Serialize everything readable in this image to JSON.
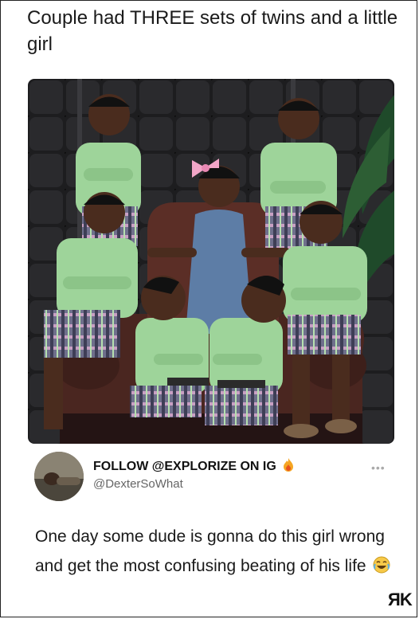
{
  "post": {
    "caption": "Couple had THREE sets of twins and a little girl"
  },
  "photo": {
    "alt": "Family photo: six boys in green shirts and plaid shorts with a girl in a denim dress and pink bow",
    "colors": {
      "wall": "#1d1d1f",
      "shirt": "#9ed49a",
      "denim": "#5d7da6",
      "bow": "#f2a6c8",
      "chair": "#4a2620"
    }
  },
  "tweet": {
    "display_name": "FOLLOW @EXPLORIZE ON IG",
    "display_icon": "fire-icon",
    "handle": "@DexterSoWhat",
    "more_label": "•••",
    "text": "One day some dude is gonna do this girl wrong and get the most confusing beating of his life",
    "text_icon": "laughing-face-icon"
  },
  "watermark": {
    "text": "ЯK"
  }
}
